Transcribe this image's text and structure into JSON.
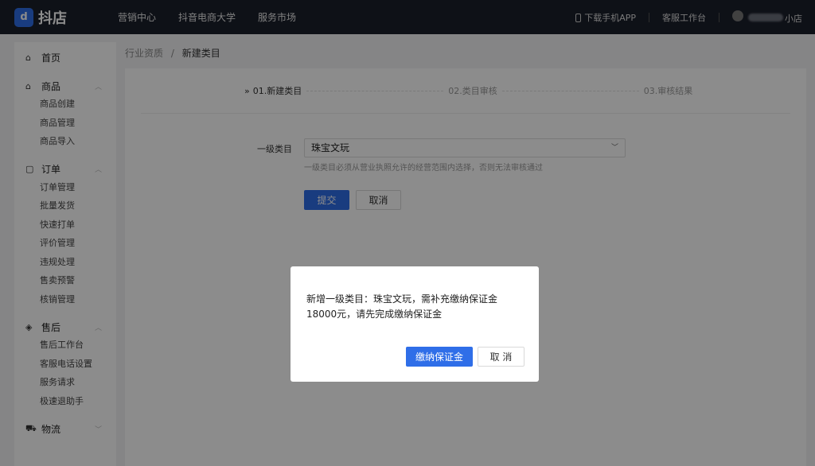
{
  "header": {
    "logo_glyph": "d",
    "brand": "抖店",
    "nav": [
      "营销中心",
      "抖音电商大学",
      "服务市场"
    ],
    "download_app": "下载手机APP",
    "service_workbench": "客服工作台",
    "store_suffix": "小店"
  },
  "sidebar": {
    "home": {
      "icon": "home-icon",
      "label": "首页"
    },
    "groups": [
      {
        "icon": "goods-icon",
        "label": "商品",
        "items": [
          "商品创建",
          "商品管理",
          "商品导入"
        ]
      },
      {
        "icon": "order-icon",
        "label": "订单",
        "items": [
          "订单管理",
          "批量发货",
          "快速打单",
          "评价管理",
          "违规处理",
          "售卖预警",
          "核销管理"
        ]
      },
      {
        "icon": "aftersale-icon",
        "label": "售后",
        "items": [
          "售后工作台",
          "客服电话设置",
          "服务请求",
          "极速退助手"
        ]
      },
      {
        "icon": "logistics-icon",
        "label": "物流",
        "items": []
      }
    ]
  },
  "breadcrumb": {
    "parent": "行业资质",
    "separator": "/",
    "current": "新建类目"
  },
  "steps": {
    "marker": "»",
    "step1": "01.新建类目",
    "step2": "02.类目审核",
    "step3": "03.审核结果"
  },
  "form": {
    "label": "一级类目",
    "selected": "珠宝文玩",
    "hint": "一级类目必须从营业执照允许的经营范围内选择，否则无法审核通过",
    "submit": "提交",
    "cancel": "取消"
  },
  "modal": {
    "message": "新增一级类目：珠宝文玩，需补充缴纳保证金18000元，请先完成缴纳保证金",
    "pay": "缴纳保证金",
    "cancel": "取 消"
  },
  "colors": {
    "primary": "#2f6ee8",
    "topbar": "#1b1f2b"
  }
}
